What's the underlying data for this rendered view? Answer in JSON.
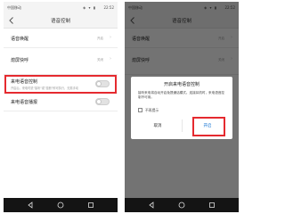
{
  "status_bar": {
    "carrier": "中国移动",
    "icons": "◈ ▾ ▮",
    "time": "22:52"
  },
  "page": {
    "title": "语音控制"
  },
  "rows": [
    {
      "title": "语音唤醒",
      "state": "开启"
    },
    {
      "title": "熄屏快呼",
      "state": "关闭"
    },
    {
      "title": "来电语音控制",
      "desc": "开启后，来电时说\"接听\"或\"挂断\"即可执行，无需手动"
    },
    {
      "title": "来电语音播报"
    }
  ],
  "dialog": {
    "title": "开启来电语音控制",
    "message": "接听来电将自动开启免提通话模式。连接耳机时，来电语音控制不可用。",
    "checkbox_label": "不再提示",
    "cancel": "取消",
    "confirm": "开启"
  },
  "colors": {
    "highlight": "#e52a2f",
    "link": "#0a6ed1",
    "navbar": "#141414"
  },
  "icons": {
    "back": "back-arrow-icon",
    "nav_back": "nav-back-icon",
    "nav_home": "nav-home-icon",
    "nav_recent": "nav-recent-icon"
  }
}
